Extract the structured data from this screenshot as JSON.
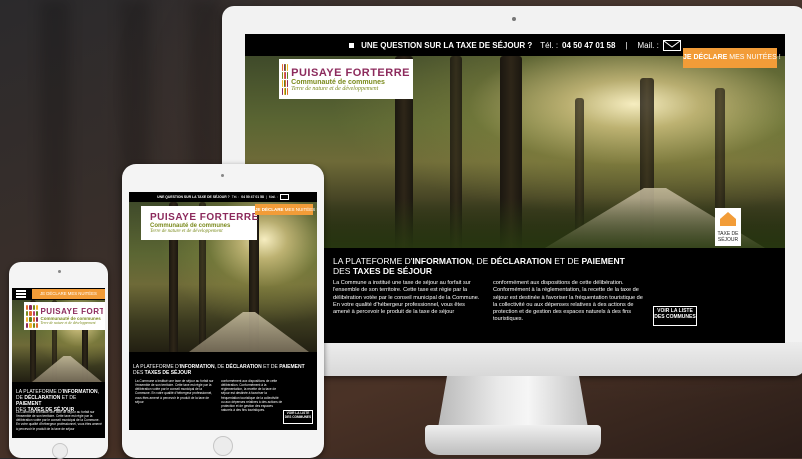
{
  "topbar": {
    "question": "UNE QUESTION SUR LA TAXE DE SÉJOUR ?",
    "tel_label": "Tél. :",
    "tel": "04 50 47 01 58",
    "separator": "|",
    "mail_label": "Mail. :",
    "mail_icon": "envelope-icon"
  },
  "logo": {
    "name": "PUISAYE FORTERRE",
    "subtitle": "Communauté de communes",
    "tagline": "Terre de nature et de développement",
    "phone_name": "PUISAYE FORTE"
  },
  "cta": {
    "bold": "JE DÉCLARE",
    "rest": "MES NUITÉES !",
    "phone_label": "JE DÉCLARE MES NUITÉES"
  },
  "badge": {
    "icon": "house-icon",
    "line1": "TAXE DE",
    "line2": "SÉJOUR"
  },
  "headline": {
    "part1": "LA PLATEFORME D'",
    "b1": "INFORMATION",
    "part2": ", DE ",
    "b2": "DÉCLARATION",
    "part3": " ET DE ",
    "b3": "PAIEMENT",
    "part4": "DES ",
    "b4": "TAXES DE SÉJOUR"
  },
  "body": {
    "col1": "La Commune a institué une taxe de séjour au forfait sur l'ensemble de son territoire. Cette taxe est régie par la délibération votée par le conseil municipal de la Commune. En votre qualité d'hébergeur professionnel, vous êtes amené à percevoir le produit de la taxe de séjour",
    "col2": "conformément aux dispositions de cette délibération. Conformément à la réglementation, la recette de la taxe de séjour est destinée à favoriser la fréquentation touristique de la collectivité ou aux dépenses relatives à des actions de protection et de gestion des espaces naturels à des fins touristiques."
  },
  "list_button": {
    "line1": "VOIR LA LISTE",
    "line2": "DES COMMUNES"
  },
  "colors": {
    "accent_orange": "#f29c38",
    "brand_purple": "#8c2a5c",
    "brand_green": "#7a8a1c",
    "bg_black": "#000000"
  }
}
